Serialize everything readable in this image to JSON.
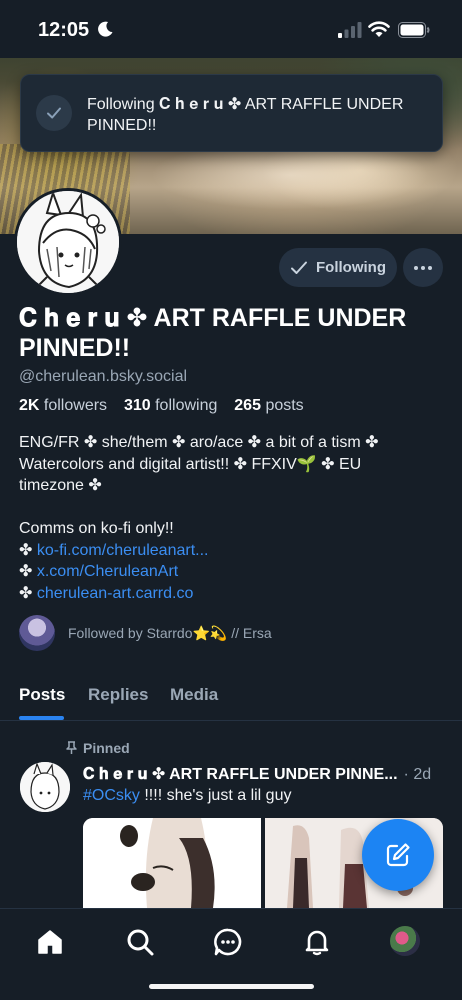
{
  "status_bar": {
    "time": "12:05"
  },
  "toast": {
    "text": "Following 𝐂 𝐡 𝐞 𝐫 𝐮 ✤ ART RAFFLE UNDER PINNED!!"
  },
  "profile": {
    "following_button": "Following",
    "display_name": "𝐂 𝐡 𝐞 𝐫 𝐮 ✤ ART RAFFLE UNDER PINNED!!",
    "handle": "@cherulean.bsky.social",
    "followers_count": "2K",
    "followers_label": "followers",
    "following_count": "310",
    "following_label": "following",
    "posts_count": "265",
    "posts_label": "posts",
    "bio_lines": [
      "ENG/FR ✤ she/them ✤ aro/ace ✤ a bit of a tism ✤",
      "Watercolors and digital artist!! ✤ FFXIV🌱 ✤ EU",
      "timezone ✤",
      "",
      "Comms on ko-fi only!!"
    ],
    "bio_bullet": "✤ ",
    "bio_links": [
      "ko-fi.com/cheruleanart...",
      "x.com/CheruleanArt",
      "cherulean-art.carrd.co"
    ],
    "followed_by": "Followed by Starrdo⭐💫 // Ersa"
  },
  "tabs": [
    "Posts",
    "Replies",
    "Media"
  ],
  "post": {
    "pinned_label": "Pinned",
    "author": "𝐂 𝐡 𝐞 𝐫 𝐮 ✤ ART RAFFLE UNDER PINNE...",
    "time": "· 2d",
    "hashtag": "#OCsky",
    "text": " !!!! she's just a lil guy"
  },
  "colors": {
    "accent": "#2a83f0",
    "link": "#3b8ef2",
    "background": "#161e27"
  },
  "icons": {
    "toast": "check-icon",
    "more": "ellipsis-icon",
    "fab": "compose-icon",
    "nav": [
      "home-icon",
      "search-icon",
      "chat-icon",
      "bell-icon",
      "profile-avatar"
    ]
  }
}
